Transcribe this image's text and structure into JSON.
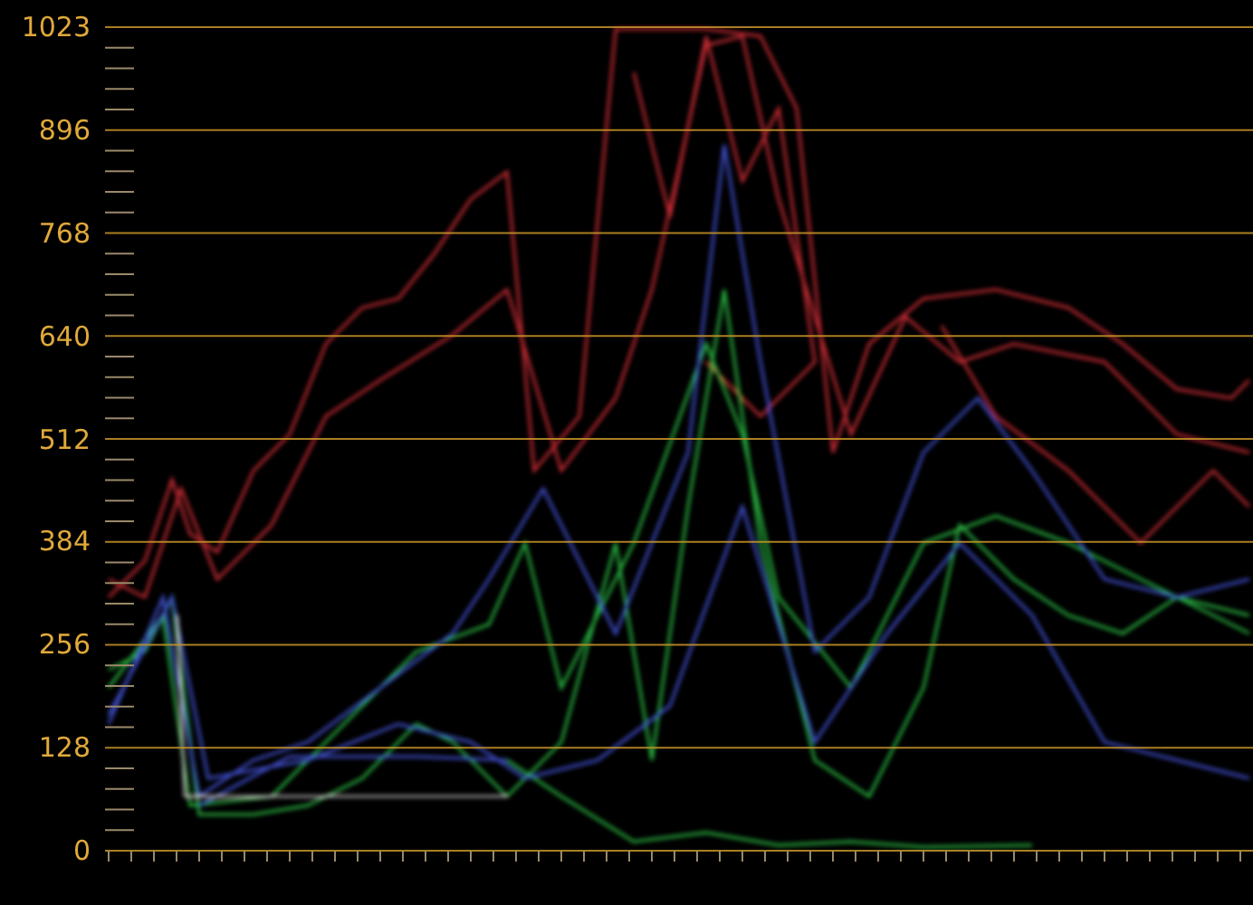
{
  "scope": {
    "y_axis_labels": [
      "1023",
      "896",
      "768",
      "640",
      "512",
      "384",
      "256",
      "128",
      "0"
    ]
  }
}
